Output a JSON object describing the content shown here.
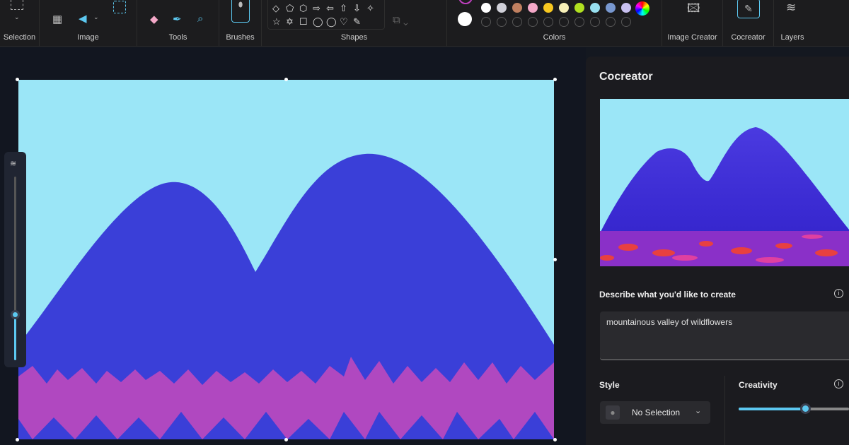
{
  "toolbar": {
    "groups": [
      "Selection",
      "Image",
      "Tools",
      "Brushes",
      "Shapes",
      "Colors",
      "Image Creator",
      "Cocreator",
      "Layers"
    ],
    "shapes": [
      "◇",
      "⬠",
      "⬡",
      "⇨",
      "⇦",
      "⇧",
      "⇩",
      "✧",
      "☆",
      "✡",
      "☐",
      "◯",
      "◯",
      "♡",
      "✎"
    ],
    "active_color": "#c040c0",
    "secondary_color": "#ffffff",
    "palette": [
      "#ffffff",
      "#d0d0d8",
      "#c08060",
      "#f4a8c8",
      "#f8c820",
      "#f8f0b8",
      "#b0e020",
      "#98e0f0",
      "#7898d0",
      "#c8c0f0"
    ],
    "active_tool": "Cocreator"
  },
  "canvas": {
    "sky_color": "#9be6f7",
    "mountain_color": "#3a3fd8",
    "flowers_color": "#b048c0"
  },
  "zoom": {
    "level": 0.25
  },
  "panel": {
    "title": "Cocreator",
    "prompt_label": "Describe what you'd like to create",
    "prompt_value": "mountainous valley of wildflowers",
    "style_label": "Style",
    "style_value": "No Selection",
    "creativity_label": "Creativity",
    "creativity_value": 0.6
  }
}
